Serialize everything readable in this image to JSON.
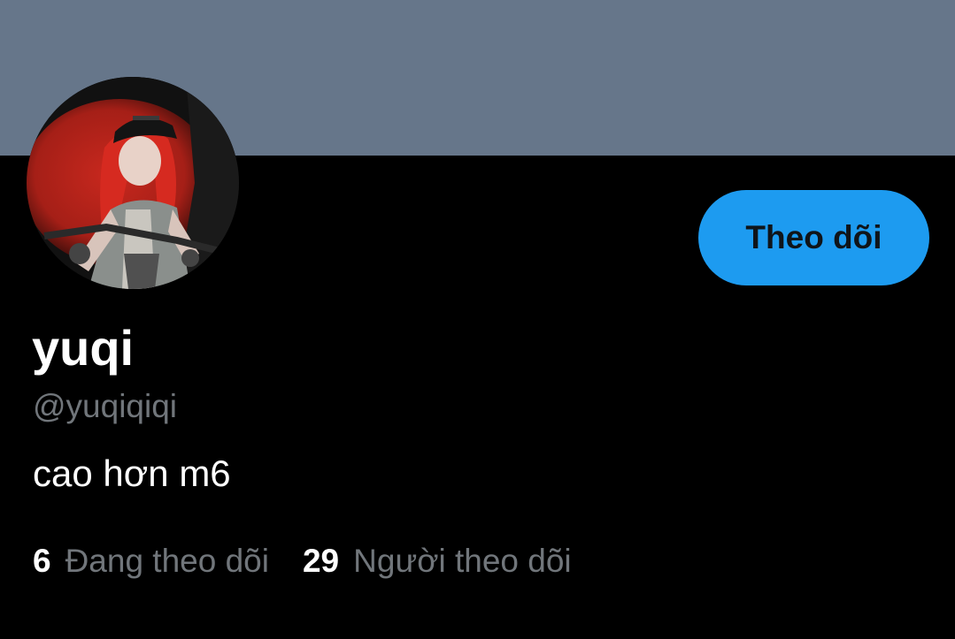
{
  "profile": {
    "display_name": "yuqi",
    "handle": "@yuqiqiqi",
    "bio": "cao hơn m6",
    "avatar_icon": "profile-photo-icon"
  },
  "actions": {
    "follow_label": "Theo dõi"
  },
  "stats": {
    "following_count": "6",
    "following_label": "Đang theo dõi",
    "followers_count": "29",
    "followers_label": "Người theo dõi"
  },
  "colors": {
    "banner": "#66768a",
    "background": "#000000",
    "accent": "#1d9bf0",
    "secondary_text": "#71767b",
    "primary_text": "#ffffff"
  }
}
